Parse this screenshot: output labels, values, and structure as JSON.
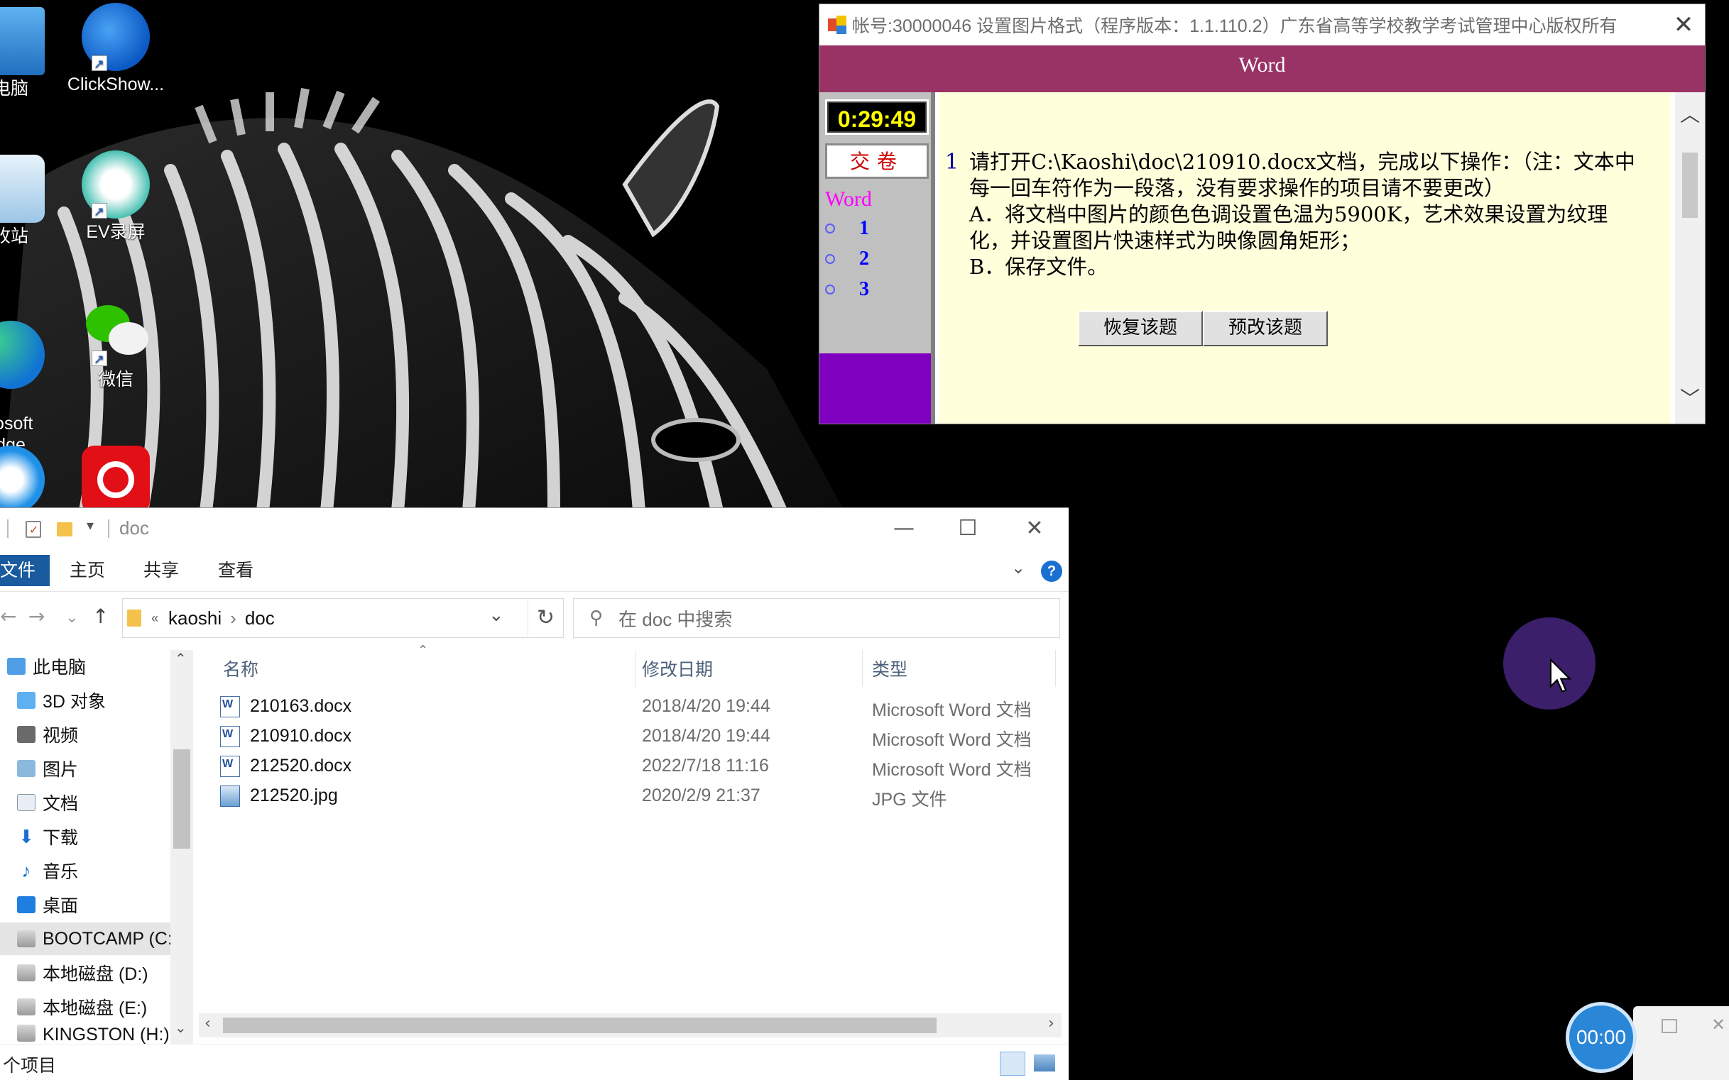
{
  "desktop": {
    "icons": [
      {
        "label": "电脑"
      },
      {
        "label": "ClickShow..."
      },
      {
        "label": "收站"
      },
      {
        "label": "EV录屏"
      },
      {
        "label": "rosoft\ndge"
      },
      {
        "label": "微信"
      }
    ]
  },
  "exam": {
    "title": "帐号:30000046  设置图片格式（程序版本：1.1.110.2）广东省高等学校教学考试管理中心版权所有",
    "close_glyph": "✕",
    "banner": "Word",
    "timer": "0:29:49",
    "submit_label": "交卷",
    "left_title": "Word",
    "questions": [
      "1",
      "2",
      "3"
    ],
    "question_number": "1",
    "question_text_1": "请打开C:\\Kaoshi\\doc\\210910.docx文档，完成以下操作：（注：文本中每一回车符作为一段落，没有要求操作的项目请不要更改）",
    "question_text_2": "A．将文档中图片的颜色色调设置色温为5900K，艺术效果设置为纹理化，并设置图片快速样式为映像圆角矩形；",
    "question_text_3": "B．保存文件。",
    "restore_label": "恢复该题",
    "redo_label": "预改该题",
    "scroll_up": "︿",
    "scroll_down": "﹀",
    "colors": {
      "banner": "#993366",
      "content": "#ffffdc",
      "timer_text": "#ffff00"
    }
  },
  "explorer": {
    "title": "doc",
    "minimize_glyph": "—",
    "maximize_glyph": "☐",
    "close_glyph": "✕",
    "tabs": {
      "file": "文件",
      "home": "主页",
      "share": "共享",
      "view": "查看"
    },
    "breadcrumb": {
      "prefix": "«",
      "part1": "kaoshi",
      "sep": "›",
      "part2": "doc"
    },
    "search_placeholder": "在 doc 中搜索",
    "nav_items": [
      {
        "label": "此电脑",
        "icon": "pc-icon"
      },
      {
        "label": "3D 对象",
        "icon": "3d-objects-icon"
      },
      {
        "label": "视频",
        "icon": "video-icon"
      },
      {
        "label": "图片",
        "icon": "pictures-icon"
      },
      {
        "label": "文档",
        "icon": "documents-icon"
      },
      {
        "label": "下载",
        "icon": "download-icon"
      },
      {
        "label": "音乐",
        "icon": "music-icon"
      },
      {
        "label": "桌面",
        "icon": "desktop-icon"
      },
      {
        "label": "BOOTCAMP (C:",
        "icon": "drive-icon"
      },
      {
        "label": "本地磁盘 (D:)",
        "icon": "drive-icon"
      },
      {
        "label": "本地磁盘 (E:)",
        "icon": "drive-icon"
      },
      {
        "label": "KINGSTON (H:)",
        "icon": "usb-drive-icon"
      }
    ],
    "columns": {
      "name": "名称",
      "date": "修改日期",
      "type": "类型"
    },
    "files": [
      {
        "name": "210163.docx",
        "date": "2018/4/20 19:44",
        "type": "Microsoft Word 文档",
        "icon": "word-file-icon"
      },
      {
        "name": "210910.docx",
        "date": "2018/4/20 19:44",
        "type": "Microsoft Word 文档",
        "icon": "word-file-icon"
      },
      {
        "name": "212520.docx",
        "date": "2022/7/18 11:16",
        "type": "Microsoft Word 文档",
        "icon": "word-file-icon"
      },
      {
        "name": "212520.jpg",
        "date": "2020/2/9 21:37",
        "type": "JPG 文件",
        "icon": "image-file-icon"
      }
    ],
    "status": "个项目"
  },
  "recorder": {
    "time": "00:00"
  }
}
